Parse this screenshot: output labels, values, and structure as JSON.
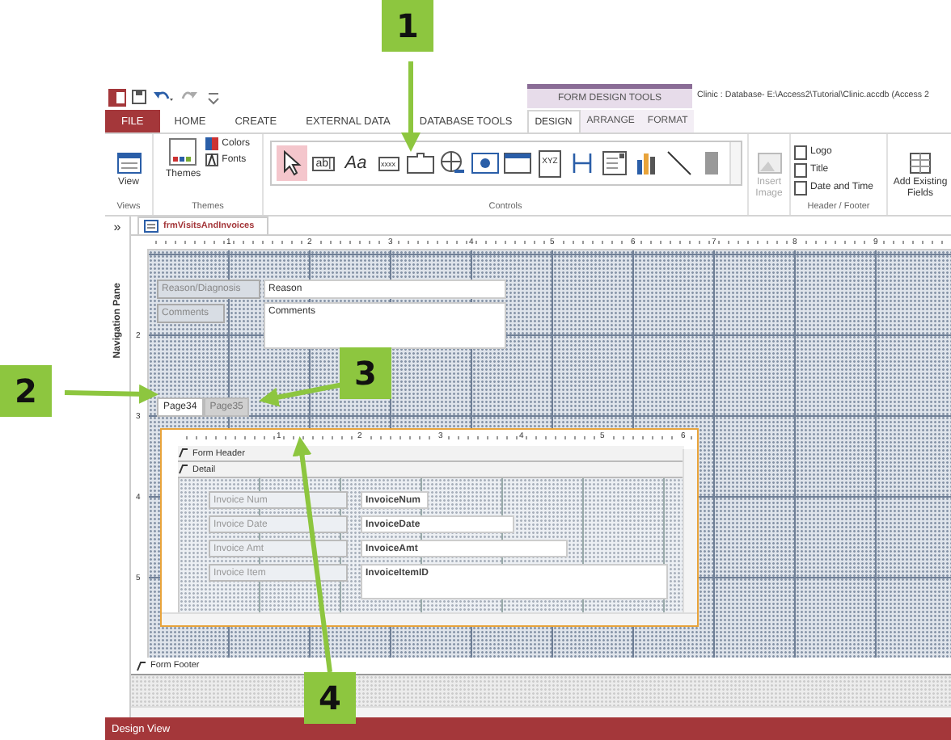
{
  "title_bar": {
    "contextual_group": "FORM DESIGN TOOLS",
    "title": "Clinic : Database- E:\\Access2\\Tutorial\\Clinic.accdb (Access 2"
  },
  "ribbon_tabs": [
    {
      "label": "FILE",
      "kind": "file",
      "selected": false
    },
    {
      "label": "HOME",
      "kind": "plain",
      "selected": false
    },
    {
      "label": "CREATE",
      "kind": "plain",
      "selected": false
    },
    {
      "label": "EXTERNAL DATA",
      "kind": "plain",
      "selected": false
    },
    {
      "label": "DATABASE TOOLS",
      "kind": "plain",
      "selected": false
    },
    {
      "label": "DESIGN",
      "kind": "contextual",
      "selected": true
    },
    {
      "label": "ARRANGE",
      "kind": "contextual",
      "selected": false
    },
    {
      "label": "FORMAT",
      "kind": "contextual",
      "selected": false
    }
  ],
  "ribbon": {
    "views": {
      "label": "Views",
      "button": "View"
    },
    "themes": {
      "label": "Themes",
      "themes": "Themes",
      "colors": "Colors",
      "fonts": "Fonts"
    },
    "controls": {
      "label": "Controls",
      "items": [
        {
          "kind": "select",
          "selected": true
        },
        {
          "kind": "textbox",
          "glyph": "ab|",
          "selected": false
        },
        {
          "kind": "label",
          "glyph": "Aa",
          "selected": false
        },
        {
          "kind": "button",
          "glyph": "xxxx",
          "selected": false
        },
        {
          "kind": "tab",
          "selected": false
        },
        {
          "kind": "hyperlink",
          "selected": false
        },
        {
          "kind": "web",
          "selected": false
        },
        {
          "kind": "navigation",
          "selected": false
        },
        {
          "kind": "group",
          "glyph": "XYZ",
          "selected": false
        },
        {
          "kind": "pagebreak",
          "selected": false
        },
        {
          "kind": "combo",
          "selected": false
        },
        {
          "kind": "chart",
          "selected": false
        },
        {
          "kind": "line",
          "selected": false
        },
        {
          "kind": "toggle",
          "selected": false
        }
      ]
    },
    "insert_image": {
      "label": "Insert Image",
      "disabled": true
    },
    "header_footer": {
      "label": "Header / Footer",
      "items": [
        "Logo",
        "Title",
        "Date and Time"
      ]
    },
    "add_fields": {
      "label": "Add Existing Fields"
    }
  },
  "navigation_pane": {
    "toggle": "»",
    "label": "Navigation Pane"
  },
  "document_tab": "frmVisitsAndInvoices",
  "ruler": [
    "1",
    "2",
    "3",
    "4",
    "5",
    "6",
    "7",
    "8",
    "9"
  ],
  "vertical_ruler": [
    "2",
    "3",
    "4",
    "5"
  ],
  "form_controls": [
    {
      "kind": "label",
      "text": "Reason/Diagnosis"
    },
    {
      "kind": "textbox",
      "text": "Reason"
    },
    {
      "kind": "label",
      "text": "Comments"
    },
    {
      "kind": "textbox",
      "text": "Comments"
    }
  ],
  "tab_control": [
    {
      "label": "Page34",
      "selected": true
    },
    {
      "label": "Page35",
      "selected": false
    }
  ],
  "subform": {
    "ruler": [
      "1",
      "2",
      "3",
      "4",
      "5",
      "6"
    ],
    "sections": [
      "Form Header",
      "Detail"
    ],
    "rows": [
      {
        "label": "Invoice Num",
        "field": "InvoiceNum"
      },
      {
        "label": "Invoice Date",
        "field": "InvoiceDate"
      },
      {
        "label": "Invoice Amt",
        "field": "InvoiceAmt"
      },
      {
        "label": "Invoice Item",
        "field": "InvoiceItemID"
      }
    ]
  },
  "form_footer": "Form Footer",
  "status_bar": "Design View",
  "callouts": [
    "1",
    "2",
    "3",
    "4"
  ]
}
